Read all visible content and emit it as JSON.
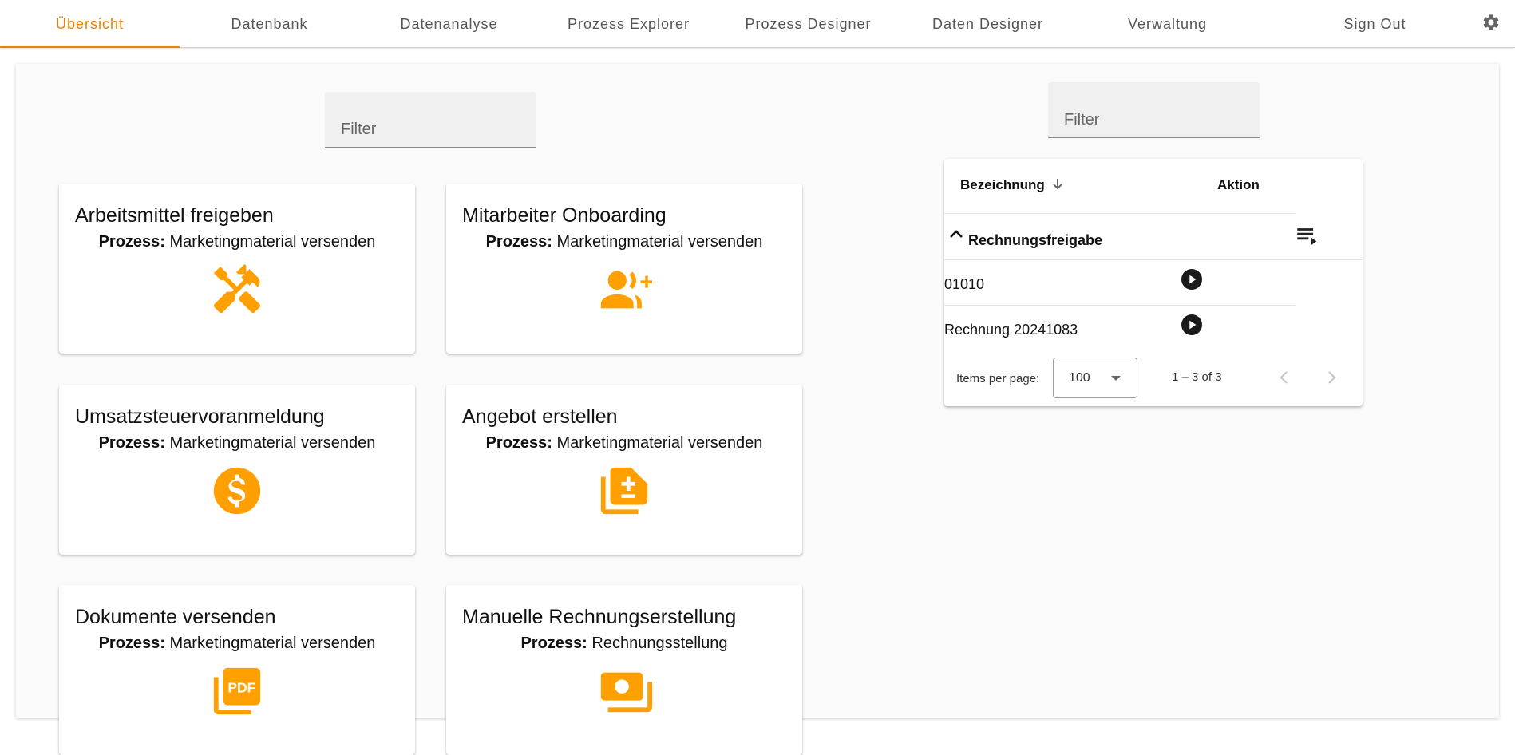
{
  "nav": {
    "tabs": [
      {
        "label": "Übersicht",
        "active": true
      },
      {
        "label": "Datenbank",
        "active": false
      },
      {
        "label": "Datenanalyse",
        "active": false
      },
      {
        "label": "Prozess Explorer",
        "active": false
      },
      {
        "label": "Prozess Designer",
        "active": false
      },
      {
        "label": "Daten Designer",
        "active": false
      },
      {
        "label": "Verwaltung",
        "active": false
      },
      {
        "label": "Sign Out",
        "active": false
      }
    ],
    "settings_icon": "gear-icon"
  },
  "left_filter": {
    "placeholder": "Filter"
  },
  "right_filter": {
    "placeholder": "Filter"
  },
  "process_prefix": "Prozess:",
  "cards": [
    {
      "title": "Arbeitsmittel freigeben",
      "process": "Marketingmaterial versenden",
      "icon": "tools-icon"
    },
    {
      "title": "Mitarbeiter Onboarding",
      "process": "Marketingmaterial versenden",
      "icon": "person-add-icon"
    },
    {
      "title": "Umsatzsteuervoranmeldung",
      "process": "Marketingmaterial versenden",
      "icon": "dollar-icon"
    },
    {
      "title": "Angebot erstellen",
      "process": "Marketingmaterial versenden",
      "icon": "document-plus-minus-icon"
    },
    {
      "title": "Dokumente versenden",
      "process": "Marketingmaterial versenden",
      "icon": "pdf-icon"
    },
    {
      "title": "Manuelle Rechnungserstellung",
      "process": "Rechnungsstellung",
      "icon": "money-icon"
    }
  ],
  "table": {
    "col_name": "Bezeichnung",
    "col_action": "Aktion",
    "group_label": "Rechnungsfreigabe",
    "rows": [
      {
        "name": "01010"
      },
      {
        "name": "Rechnung 20241083"
      }
    ],
    "paginator": {
      "items_per_page_label": "Items per page:",
      "page_size": "100",
      "range_label": "1 – 3 of 3"
    }
  },
  "colors": {
    "accent": "#ef7d00",
    "icon": "#ffa000"
  }
}
